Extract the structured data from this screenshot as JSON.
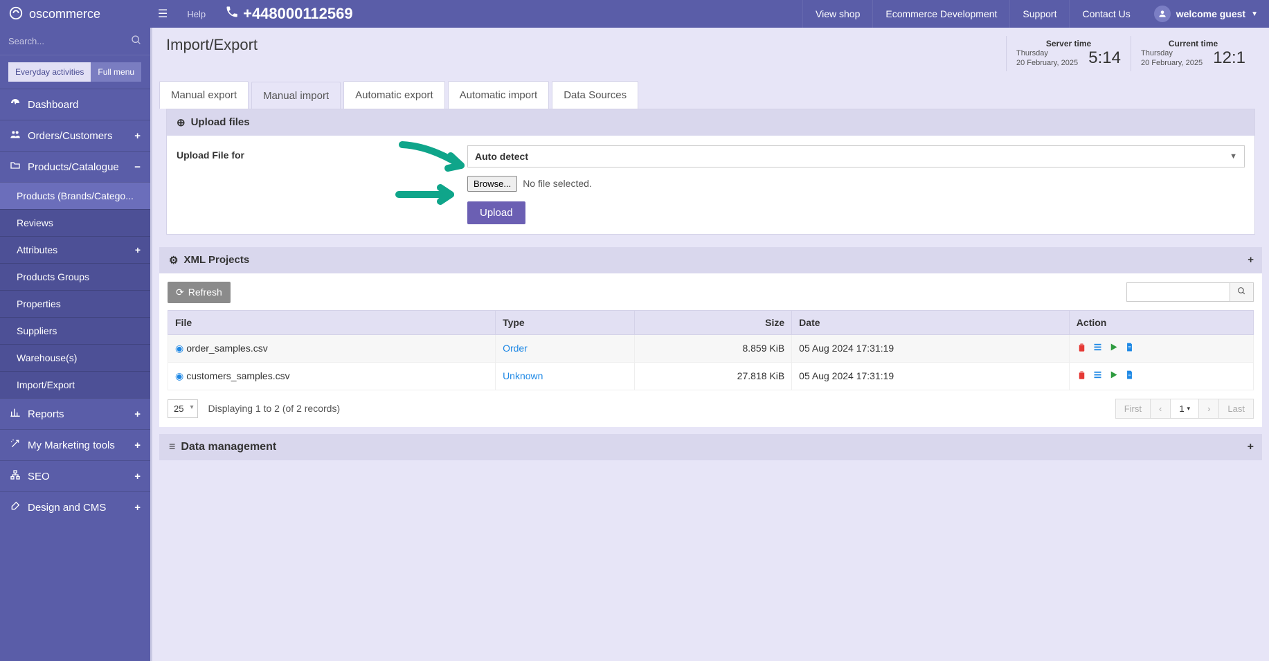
{
  "header": {
    "brand": "oscommerce",
    "help": "Help",
    "phone": "+448000112569",
    "links": [
      "View shop",
      "Ecommerce Development",
      "Support",
      "Contact Us"
    ],
    "welcome": "welcome guest"
  },
  "sidebar": {
    "search_placeholder": "Search...",
    "mode_everyday": "Everyday activities",
    "mode_full": "Full menu",
    "items": [
      {
        "label": "Dashboard",
        "icon": "dashboard-icon"
      },
      {
        "label": "Orders/Customers",
        "icon": "users-icon",
        "expand": "+"
      },
      {
        "label": "Products/Catalogue",
        "icon": "folder-icon",
        "expand": "−",
        "open": true,
        "children": [
          {
            "label": "Products (Brands/Catego..."
          },
          {
            "label": "Reviews"
          },
          {
            "label": "Attributes",
            "expand": "+"
          },
          {
            "label": "Products Groups"
          },
          {
            "label": "Properties"
          },
          {
            "label": "Suppliers"
          },
          {
            "label": "Warehouse(s)"
          },
          {
            "label": "Import/Export",
            "active": true
          }
        ]
      },
      {
        "label": "Reports",
        "icon": "chart-icon",
        "expand": "+"
      },
      {
        "label": "My Marketing tools",
        "icon": "magic-icon",
        "expand": "+"
      },
      {
        "label": "SEO",
        "icon": "sitemap-icon",
        "expand": "+"
      },
      {
        "label": "Design and CMS",
        "icon": "brush-icon",
        "expand": "+"
      }
    ]
  },
  "page": {
    "title": "Import/Export",
    "server_time": {
      "title": "Server time",
      "day": "Thursday",
      "date": "20 February, 2025",
      "clock": "5:14"
    },
    "current_time": {
      "title": "Current time",
      "day": "Thursday",
      "date": "20 February, 2025",
      "clock": "12:1"
    }
  },
  "tabs": [
    "Manual export",
    "Manual import",
    "Automatic export",
    "Automatic import",
    "Data Sources"
  ],
  "active_tab_index": 1,
  "upload_panel": {
    "title": "Upload files",
    "label": "Upload File for",
    "select_value": "Auto detect",
    "browse": "Browse...",
    "no_file": "No file selected.",
    "upload_btn": "Upload"
  },
  "xml_panel": {
    "title": "XML Projects",
    "refresh": "Refresh",
    "columns": [
      "File",
      "Type",
      "Size",
      "Date",
      "Action"
    ],
    "rows": [
      {
        "file": "order_samples.csv",
        "type": "Order",
        "size": "8.859 KiB",
        "date": "05 Aug 2024 17:31:19"
      },
      {
        "file": "customers_samples.csv",
        "type": "Unknown",
        "size": "27.818 KiB",
        "date": "05 Aug 2024 17:31:19"
      }
    ],
    "page_size": "25",
    "display_text": "Displaying 1 to 2 (of 2 records)",
    "pager": {
      "first": "First",
      "page": "1",
      "last": "Last"
    }
  },
  "dm_panel": {
    "title": "Data management"
  }
}
